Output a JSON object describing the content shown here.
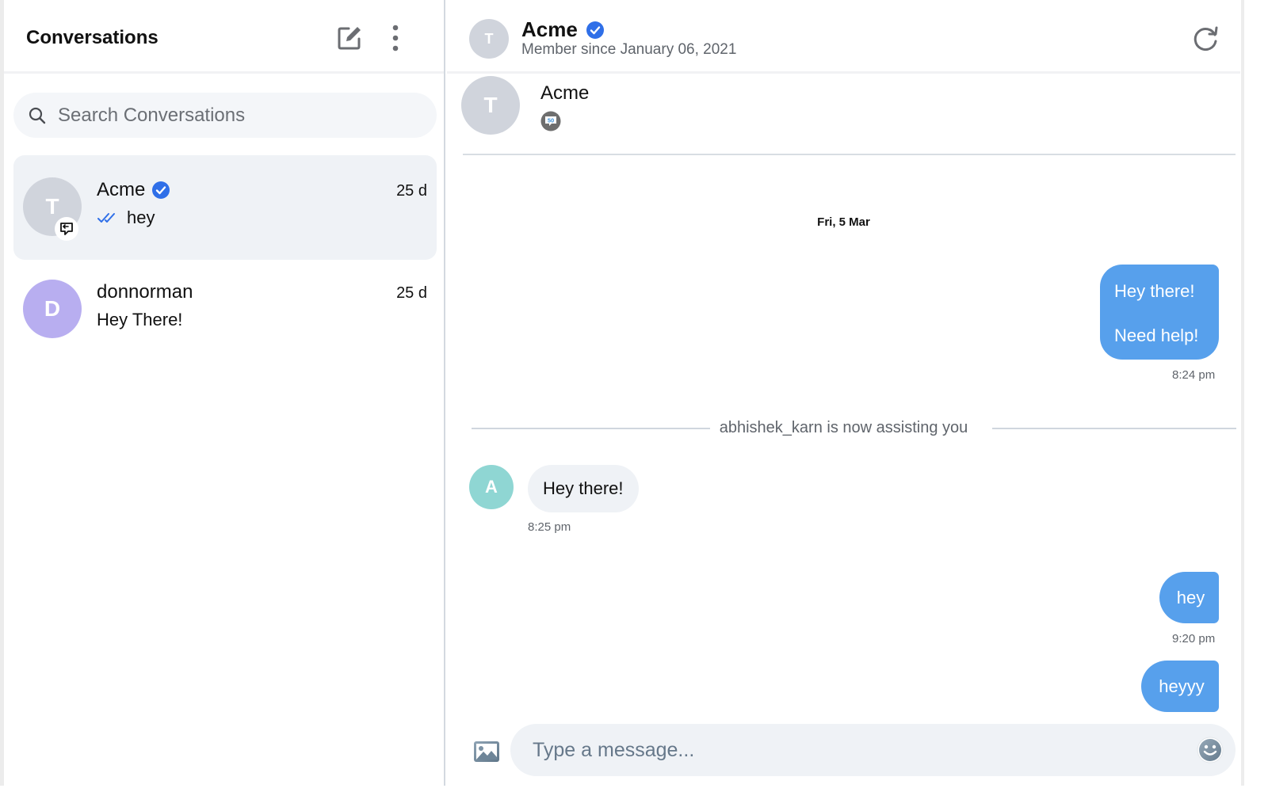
{
  "sidebar": {
    "title": "Conversations",
    "compose_icon": "compose-edit-icon",
    "more_icon": "more-vertical-icon",
    "search": {
      "placeholder": "Search Conversations",
      "value": "",
      "icon": "search-icon"
    },
    "conversations": [
      {
        "initial": "T",
        "avatar_color": "#d0d4dc",
        "name": "Acme",
        "verified": true,
        "time": "25 d",
        "preview": "hey",
        "read_receipt": "double-check-icon",
        "channel_badge": "chat-bubble-icon",
        "active": true
      },
      {
        "initial": "D",
        "avatar_color": "#b8aef0",
        "name": "donnorman",
        "verified": false,
        "time": "25 d",
        "preview": "Hey There!",
        "active": false
      }
    ]
  },
  "chat": {
    "header": {
      "initial": "T",
      "name": "Acme",
      "verified": true,
      "subtitle": "Member since January 06, 2021",
      "refresh_icon": "refresh-icon"
    },
    "profile": {
      "initial": "T",
      "name": "Acme",
      "badge": "50-chat-badge-icon"
    },
    "date_separator": "Fri, 5 Mar",
    "messages": [
      {
        "direction": "outgoing",
        "lines": [
          "Hey there!",
          "Need help!"
        ],
        "time": "8:24 pm"
      },
      {
        "type": "system",
        "text": "abhishek_karn is now assisting you"
      },
      {
        "direction": "incoming",
        "sender_initial": "A",
        "text": "Hey there!",
        "time": "8:25 pm"
      },
      {
        "direction": "outgoing",
        "text": "hey",
        "time": "9:20 pm"
      },
      {
        "direction": "outgoing",
        "text": "heyyy",
        "time": ""
      }
    ],
    "composer": {
      "placeholder": "Type a message...",
      "value": "",
      "attach_icon": "image-icon",
      "emoji_icon": "emoji-smile-icon"
    }
  },
  "colors": {
    "accent": "#57a0ec",
    "verified": "#2f6fe8",
    "incoming_bubble": "#eff2f6",
    "agent_avatar": "#8fd6d3"
  }
}
